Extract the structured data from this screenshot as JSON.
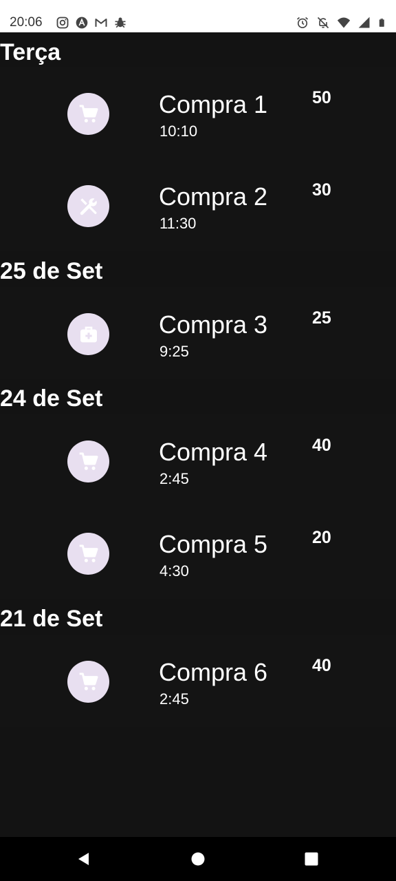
{
  "status_bar": {
    "time": "20:06",
    "left_icons": [
      "instagram-icon",
      "a-icon",
      "gmail-icon",
      "bug-icon"
    ],
    "right_icons": [
      "alarm-icon",
      "notifications-off-icon",
      "wifi-icon",
      "signal-icon",
      "battery-icon"
    ]
  },
  "sections": [
    {
      "header": "Terça",
      "items": [
        {
          "title": "Compra 1",
          "time": "10:10",
          "amount": "50",
          "icon": "shopping-cart-icon"
        },
        {
          "title": "Compra 2",
          "time": "11:30",
          "amount": "30",
          "icon": "tools-icon"
        }
      ]
    },
    {
      "header": "25 de Set",
      "items": [
        {
          "title": "Compra 3",
          "time": "9:25",
          "amount": "25",
          "icon": "medical-bag-icon"
        }
      ]
    },
    {
      "header": "24 de Set",
      "items": [
        {
          "title": "Compra 4",
          "time": "2:45",
          "amount": "40",
          "icon": "shopping-cart-icon"
        },
        {
          "title": "Compra 5",
          "time": "4:30",
          "amount": "20",
          "icon": "shopping-cart-icon"
        }
      ]
    },
    {
      "header": "21 de Set",
      "items": [
        {
          "title": "Compra 6",
          "time": "2:45",
          "amount": "40",
          "icon": "shopping-cart-icon"
        }
      ]
    }
  ],
  "nav_bar": {
    "buttons": [
      "back-icon",
      "home-icon",
      "recents-icon"
    ]
  },
  "colors": {
    "background": "#131313",
    "avatar": "#e8dff0",
    "text": "#ffffff"
  }
}
